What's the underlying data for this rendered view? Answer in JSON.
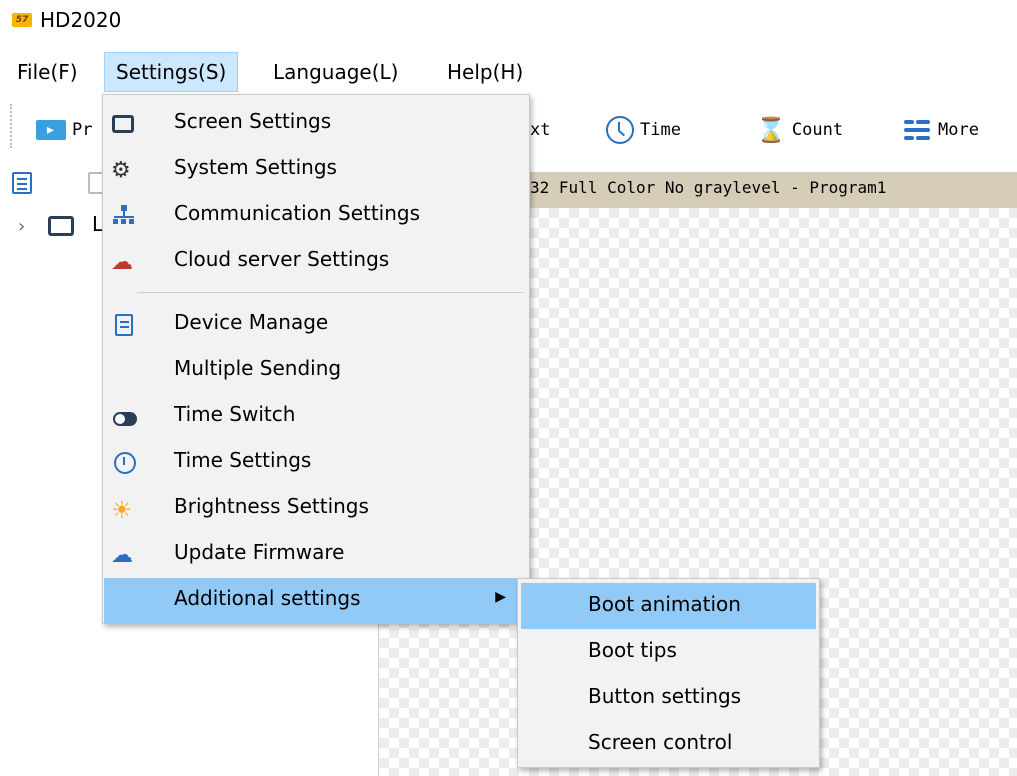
{
  "app": {
    "title": "HD2020",
    "logo_text": "🟊"
  },
  "menubar": {
    "file": "File(F)",
    "settings": "Settings(S)",
    "language": "Language(L)",
    "help": "Help(H)"
  },
  "toolbar": {
    "program_partial": "Pr",
    "text_partial": "xt",
    "time": "Time",
    "count": "Count",
    "more": "More"
  },
  "left_panel": {
    "tree_label_partial": "L"
  },
  "editor": {
    "header_text": "32 Full Color No graylevel - Program1"
  },
  "settings_menu": {
    "items": [
      {
        "label": "Screen Settings",
        "icon": "screen-icon"
      },
      {
        "label": "System Settings",
        "icon": "gear-icon"
      },
      {
        "label": "Communication Settings",
        "icon": "network-icon"
      },
      {
        "label": "Cloud server Settings",
        "icon": "cloud-icon"
      },
      {
        "label": "Device Manage",
        "icon": "document-icon"
      },
      {
        "label": "Multiple Sending",
        "icon": ""
      },
      {
        "label": "Time Switch",
        "icon": "toggle-icon"
      },
      {
        "label": "Time Settings",
        "icon": "clock-icon"
      },
      {
        "label": "Brightness Settings",
        "icon": "sun-icon"
      },
      {
        "label": "Update Firmware",
        "icon": "upload-icon"
      },
      {
        "label": "Additional settings",
        "icon": "",
        "has_submenu": true,
        "highlighted": true
      }
    ]
  },
  "additional_submenu": {
    "items": [
      {
        "label": "Boot animation",
        "highlighted": true
      },
      {
        "label": "Boot tips"
      },
      {
        "label": "Button settings"
      },
      {
        "label": "Screen control"
      }
    ]
  },
  "colors": {
    "menu_highlight": "#91c9f7",
    "menubar_active": "#cce8ff",
    "editor_header": "#d6cdb8",
    "accent_blue": "#2a6fc6"
  }
}
